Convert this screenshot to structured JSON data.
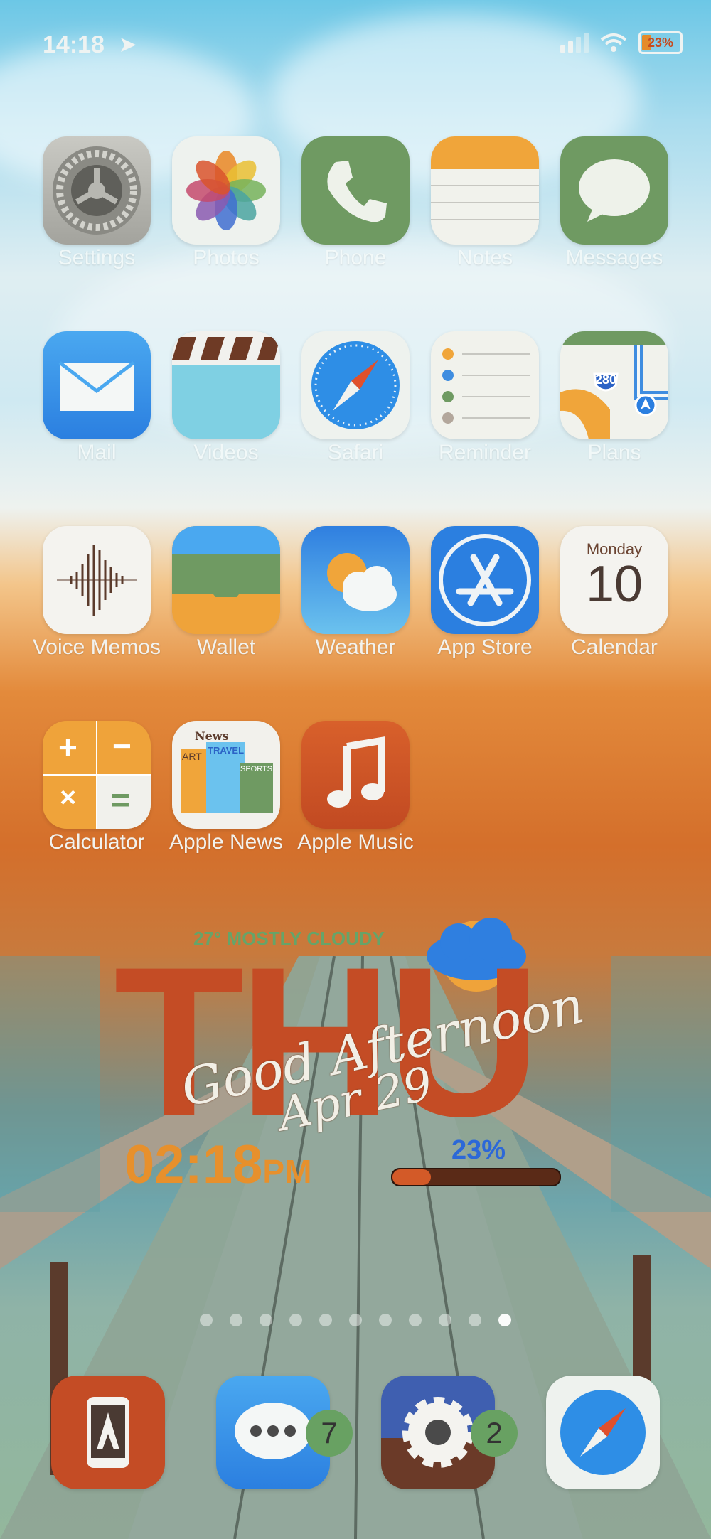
{
  "status_bar": {
    "time": "14:18",
    "battery": "23%"
  },
  "apps": [
    {
      "id": "settings",
      "label": "Settings"
    },
    {
      "id": "photos",
      "label": "Photos"
    },
    {
      "id": "phone",
      "label": "Phone"
    },
    {
      "id": "notes",
      "label": "Notes"
    },
    {
      "id": "messages",
      "label": "Messages"
    },
    {
      "id": "mail",
      "label": "Mail"
    },
    {
      "id": "videos",
      "label": "Videos"
    },
    {
      "id": "safari",
      "label": "Safari"
    },
    {
      "id": "reminder",
      "label": "Reminder"
    },
    {
      "id": "plans",
      "label": "Plans"
    },
    {
      "id": "voice_memos",
      "label": "Voice Memos"
    },
    {
      "id": "wallet",
      "label": "Wallet"
    },
    {
      "id": "weather",
      "label": "Weather"
    },
    {
      "id": "app_store",
      "label": "App Store"
    },
    {
      "id": "calendar",
      "label": "Calendar",
      "day_name": "Monday",
      "day_number": "10"
    },
    {
      "id": "calculator",
      "label": "Calculator"
    },
    {
      "id": "apple_news",
      "label": "Apple News"
    },
    {
      "id": "apple_music",
      "label": "Apple Music"
    }
  ],
  "plans_route_number": "280",
  "news_icon_text": {
    "news": "News",
    "art": "ART",
    "travel": "TRAVEL",
    "sports": "SPORTS"
  },
  "widget": {
    "weather": "27° MOSTLY CLOUDY",
    "day": "THU",
    "greeting": "Good Afternoon",
    "date": "Apr 29",
    "time": "02:18",
    "ampm": "PM",
    "battery_text": "23%",
    "battery_level": 0.23
  },
  "page_dots": {
    "count": 11,
    "active_index": 10
  },
  "dock": [
    {
      "id": "dock-app-1",
      "icon": "phone-a-icon"
    },
    {
      "id": "dock-messages",
      "icon": "chat-bubble-icon",
      "badge": "7"
    },
    {
      "id": "dock-settings",
      "icon": "gear-icon",
      "badge": "2"
    },
    {
      "id": "dock-safari",
      "icon": "compass-icon"
    }
  ]
}
